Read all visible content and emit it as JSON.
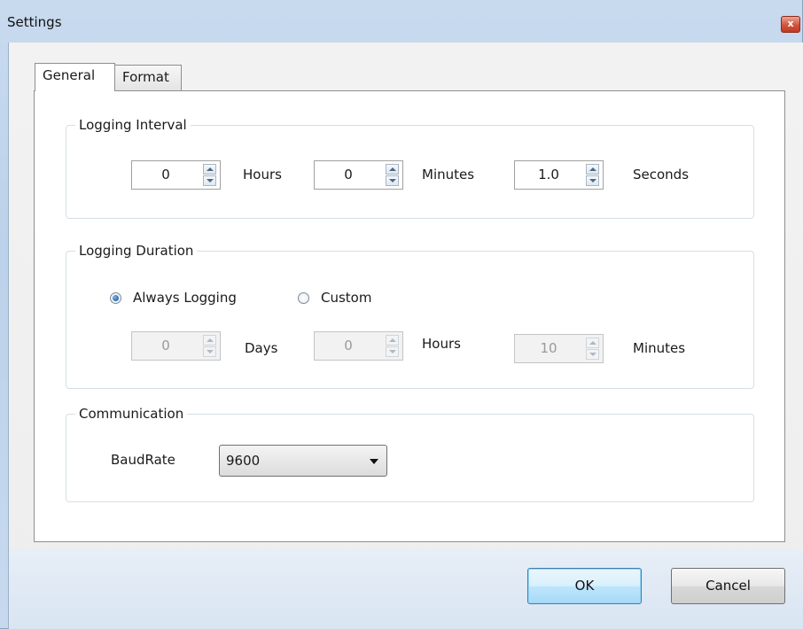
{
  "window": {
    "title": "Settings",
    "close_glyph": "x"
  },
  "tabs": [
    {
      "label": "General",
      "active": true
    },
    {
      "label": "Format",
      "active": false
    }
  ],
  "logging_interval": {
    "legend": "Logging Interval",
    "hours": {
      "value": "0",
      "unit": "Hours"
    },
    "minutes": {
      "value": "0",
      "unit": "Minutes"
    },
    "seconds": {
      "value": "1.0",
      "unit": "Seconds"
    }
  },
  "logging_duration": {
    "legend": "Logging Duration",
    "options": [
      {
        "label": "Always Logging",
        "selected": true
      },
      {
        "label": "Custom",
        "selected": false
      }
    ],
    "days": {
      "value": "0",
      "unit": "Days",
      "enabled": false
    },
    "hours": {
      "value": "0",
      "unit": "Hours",
      "enabled": false
    },
    "minutes": {
      "value": "10",
      "unit": "Minutes",
      "enabled": false
    }
  },
  "communication": {
    "legend": "Communication",
    "baudrate_label": "BaudRate",
    "baudrate_value": "9600"
  },
  "buttons": {
    "ok": "OK",
    "cancel": "Cancel"
  },
  "icons": {
    "close": "close-icon",
    "spin_up": "spin-up-arrow-icon",
    "spin_down": "spin-down-arrow-icon",
    "dropdown": "chevron-down-icon"
  },
  "colors": {
    "title_gradient": "#c8daee",
    "close_button": "#d2533b",
    "client_background": "#f0f0f0",
    "ok_button_highlight": "#bee6fd",
    "radio_selected": "#1f5fa8"
  }
}
